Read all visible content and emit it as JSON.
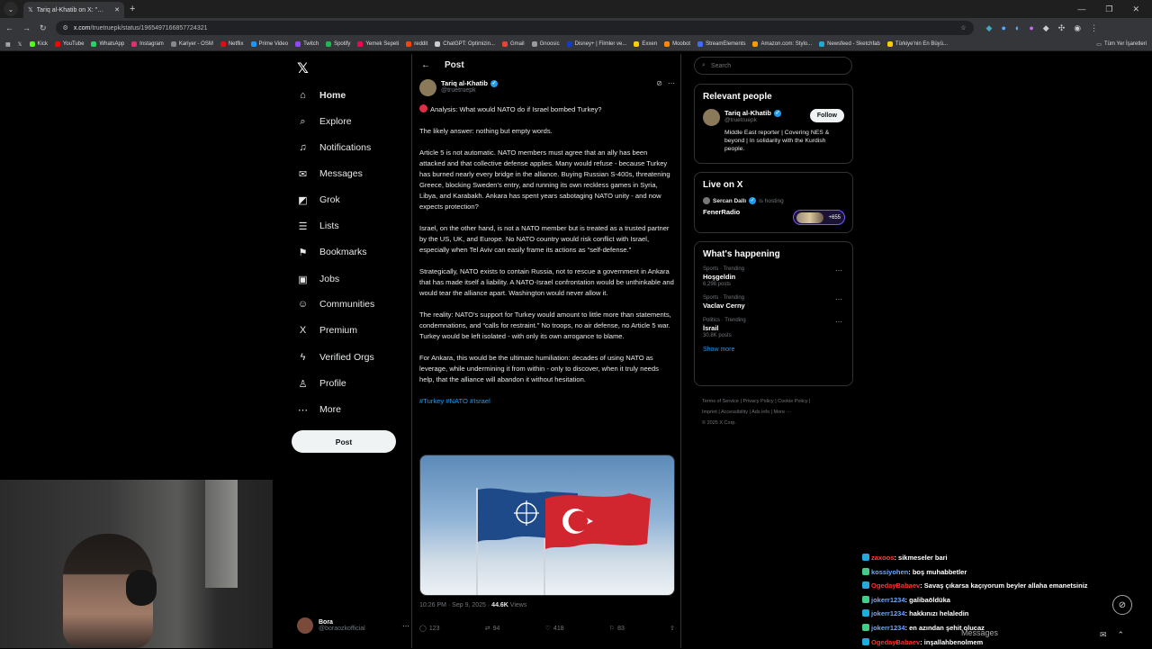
{
  "browser": {
    "tab_title": "Tariq al-Khatib on X: \"🔴 Analy",
    "url_host": "x.com",
    "url_path": "/truetruepk/status/1965497166857724321",
    "bookmarks": [
      {
        "label": "Kick",
        "color": "#53fc18"
      },
      {
        "label": "YouTube",
        "color": "#ff0000"
      },
      {
        "label": "WhatsApp",
        "color": "#25d366"
      },
      {
        "label": "Instagram",
        "color": "#e1306c"
      },
      {
        "label": "Kariyer - OSM",
        "color": "#888888"
      },
      {
        "label": "Netflix",
        "color": "#e50914"
      },
      {
        "label": "Prime Video",
        "color": "#1a98ff"
      },
      {
        "label": "Twitch",
        "color": "#9146ff"
      },
      {
        "label": "Spotify",
        "color": "#1db954"
      },
      {
        "label": "Yemek Sepeti",
        "color": "#fa0050"
      },
      {
        "label": "reddit",
        "color": "#ff4500"
      },
      {
        "label": "ChatGPT: Optimizin...",
        "color": "#cccccc"
      },
      {
        "label": "Gmail",
        "color": "#ea4335"
      },
      {
        "label": "Gnoosic",
        "color": "#999999"
      },
      {
        "label": "Disney+ | Filmler ve...",
        "color": "#113ccf"
      },
      {
        "label": "Exxen",
        "color": "#ffcc00"
      },
      {
        "label": "Moobot",
        "color": "#ff8800"
      },
      {
        "label": "StreamElements",
        "color": "#3f6cfc"
      },
      {
        "label": "Amazon.com: Stylo...",
        "color": "#ff9900"
      },
      {
        "label": "Newsfeed - Sketchfab",
        "color": "#1caad9"
      },
      {
        "label": "Türkiye'nin En Büyü...",
        "color": "#ffcc00"
      }
    ],
    "bookmarks_all": "Tüm Yer İşaretleri"
  },
  "nav": {
    "items": [
      {
        "label": "Home",
        "icon": "⌂"
      },
      {
        "label": "Explore",
        "icon": "⌕"
      },
      {
        "label": "Notifications",
        "icon": "♫"
      },
      {
        "label": "Messages",
        "icon": "✉"
      },
      {
        "label": "Grok",
        "icon": "◩"
      },
      {
        "label": "Lists",
        "icon": "☰"
      },
      {
        "label": "Bookmarks",
        "icon": "⚑"
      },
      {
        "label": "Jobs",
        "icon": "▣"
      },
      {
        "label": "Communities",
        "icon": "☺"
      },
      {
        "label": "Premium",
        "icon": "X"
      },
      {
        "label": "Verified Orgs",
        "icon": "ϟ"
      },
      {
        "label": "Profile",
        "icon": "♙"
      },
      {
        "label": "More",
        "icon": "⋯"
      }
    ],
    "post_button": "Post",
    "account_name": "Bora",
    "account_handle": "@boraozkofficial"
  },
  "post": {
    "header": "Post",
    "author_name": "Tariq al-Khatib",
    "author_handle": "@truetruepk",
    "headline": "Analysis: What would NATO do if Israel bombed Turkey?",
    "paragraphs": [
      "The likely answer: nothing but empty words.",
      "Article 5 is not automatic. NATO members must agree that an ally has been attacked and that collective defense applies. Many would refuse - because Turkey has burned nearly every bridge in the alliance. Buying Russian S-400s, threatening Greece, blocking Sweden's entry, and running its own reckless games in Syria, Libya, and Karabakh. Ankara has spent years sabotaging NATO unity - and now expects protection?",
      "Israel, on the other hand, is not a NATO member but is treated as a trusted partner by the US, UK, and Europe. No NATO country would risk conflict with Israel, especially when Tel Aviv can easily frame its actions as “self-defense.”",
      "Strategically, NATO exists to contain Russia, not to rescue a government in Ankara that has made itself a liability. A NATO-Israel confrontation would be unthinkable and would tear the alliance apart. Washington would never allow it.",
      "The reality: NATO's support for Turkey would amount to little more than statements, condemnations, and “calls for restraint.” No troops, no air defense, no Article 5 war. Turkey would be left isolated - with only its own arrogance to blame.",
      "For Ankara, this would be the ultimate humiliation: decades of using NATO as leverage, while undermining it from within - only to discover, when it truly needs help, that the alliance will abandon it without hesitation."
    ],
    "hashtags": "#Turkey #NATO #Israel",
    "timestamp": "10:26 PM · Sep 9, 2025 · ",
    "views_count": "44.6K",
    "views_label": " Views",
    "replies": "123",
    "reposts": "94",
    "likes": "418",
    "bookmarks": "83"
  },
  "right": {
    "search_placeholder": "Search",
    "relevant_title": "Relevant people",
    "rp_name": "Tariq al-Khatib",
    "rp_handle": "@truetruepk",
    "rp_follow": "Follow",
    "rp_bio": "Middle East reporter | Covering NES & beyond | In solidarity with the Kurdish people.",
    "live_title": "Live on X",
    "live_host_name": "Sercan Dallı",
    "live_host_suffix": "is hosting",
    "live_space": "FenerRadio",
    "live_count": "+655",
    "happening_title": "What's happening",
    "trends": [
      {
        "context": "Sports · Trending",
        "title": "Hoşgeldin",
        "count": "6,298 posts"
      },
      {
        "context": "Sports · Trending",
        "title": "Vaclav Cerny",
        "count": ""
      },
      {
        "context": "Politics · Trending",
        "title": "İsrail",
        "count": "30.8K posts"
      }
    ],
    "show_more": "Show more",
    "footer_line1": "Terms of Service  |  Privacy Policy  |  Cookie Policy  |",
    "footer_line2": "Imprint  |  Accessibility  |  Ads info  |  More ···",
    "footer_line3": "© 2025 X Corp."
  },
  "chat": {
    "messages": [
      {
        "user": "zaxoos",
        "text": ": sikmeseler bari",
        "color": "#ff4444"
      },
      {
        "user": "kossiyohen",
        "text": ": boş muhabbetler",
        "color": "#6fa8ff"
      },
      {
        "user": "OgedayBabaev",
        "text": ": Savaş çıkarsa kaçıyorum beyler allaha emanetsiniz",
        "color": "#ff3333"
      },
      {
        "user": "jokerr1234",
        "text": ": galibaöldüka",
        "color": "#6fa8ff"
      },
      {
        "user": "jokerr1234",
        "text": ": hakkınızı helaledin",
        "color": "#6fa8ff"
      },
      {
        "user": "jokerr1234",
        "text": ": en azından şehit olucaz",
        "color": "#6fa8ff"
      },
      {
        "user": "OgedayBabaev",
        "text": ": inşallahbenolmem",
        "color": "#ff3333"
      }
    ],
    "messages_bar": "Messages"
  }
}
